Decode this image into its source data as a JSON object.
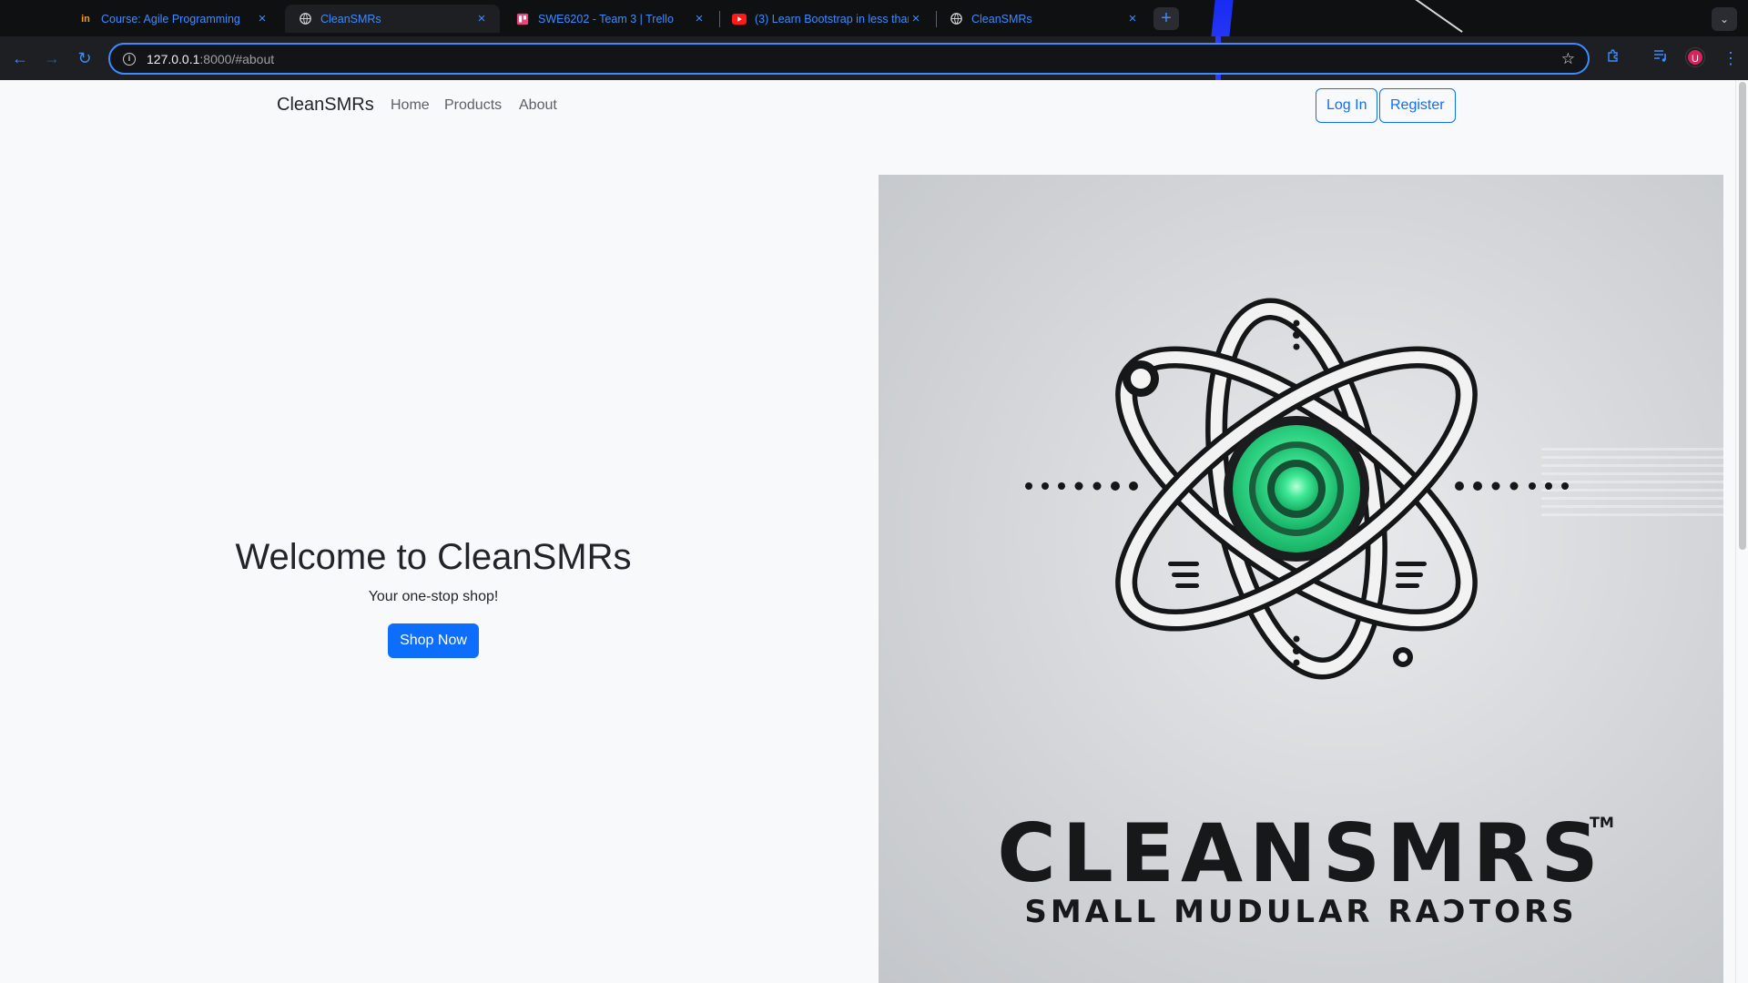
{
  "browser": {
    "tabs": [
      {
        "title": "Course: Agile Programming",
        "favicon": "in",
        "active": false
      },
      {
        "title": "CleanSMRs",
        "favicon": "globe",
        "active": true
      },
      {
        "title": "SWE6202 - Team 3 | Trello",
        "favicon": "trello",
        "active": false
      },
      {
        "title": "(3) Learn Bootstrap in less than",
        "favicon": "youtube",
        "active": false
      },
      {
        "title": "CleanSMRs",
        "favicon": "globe",
        "active": false
      }
    ],
    "new_tab_label": "+",
    "address": {
      "host": "127.0.0.1",
      "rest": ":8000/#about"
    },
    "avatar_initial": "U",
    "accent_color": "#3d8cff"
  },
  "site": {
    "brand": "CleanSMRs",
    "nav": {
      "home": "Home",
      "products": "Products",
      "about": "About"
    },
    "auth": {
      "login": "Log In",
      "register": "Register"
    },
    "hero": {
      "title": "Welcome to CleanSMRs",
      "subtitle": "Your one-stop shop!",
      "cta": "Shop Now"
    },
    "logo": {
      "wordmark": "CLEANSMRS",
      "tm": "TM",
      "tagline": "SMALL MUDULAR RAƆTORS"
    },
    "colors": {
      "primary": "#0d6efd",
      "logo_green": "#2ee08a",
      "page_bg": "#f8f9fa"
    }
  }
}
